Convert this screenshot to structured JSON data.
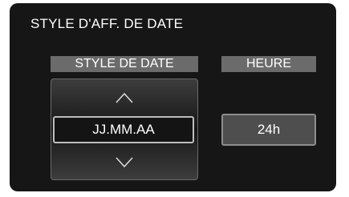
{
  "screen": {
    "title": "STYLE D'AFF. DE DATE"
  },
  "date_style": {
    "header": "STYLE DE DATE",
    "selected_value": "JJ.MM.AA",
    "up_icon": "chevron-up-icon",
    "down_icon": "chevron-down-icon"
  },
  "time": {
    "header": "HEURE",
    "value": "24h"
  },
  "colors": {
    "background": "#161616",
    "header_bar": "#6b6b6b",
    "selection_border": "#bdbdbd",
    "time_box": "#4e4e4e"
  }
}
